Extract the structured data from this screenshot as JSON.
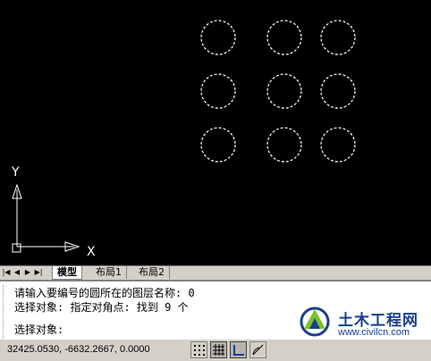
{
  "drawing": {
    "axis_y_label": "Y",
    "axis_x_label": "X"
  },
  "tabs": {
    "nav_icons": [
      "first-icon",
      "prev-icon",
      "next-icon",
      "last-icon"
    ],
    "items": [
      {
        "label": "模型",
        "active": true
      },
      {
        "label": "布局1",
        "active": false
      },
      {
        "label": "布局2",
        "active": false
      }
    ]
  },
  "command": {
    "line1": "请输入要编号的圆所在的图层名称: 0",
    "line2": "选择对象: 指定对角点: 找到 9 个",
    "line3": "选择对象:"
  },
  "status": {
    "coordinates": "32425.0530, -6632.2667, 0.0000",
    "buttons": [
      "snap-icon",
      "grid-icon",
      "ortho-icon",
      "polar-icon"
    ]
  },
  "watermark": {
    "name": "土木工程网",
    "url": "www.civilcn.com",
    "colors": {
      "blue": "#1a3f8f",
      "green": "#7cc12b"
    }
  }
}
